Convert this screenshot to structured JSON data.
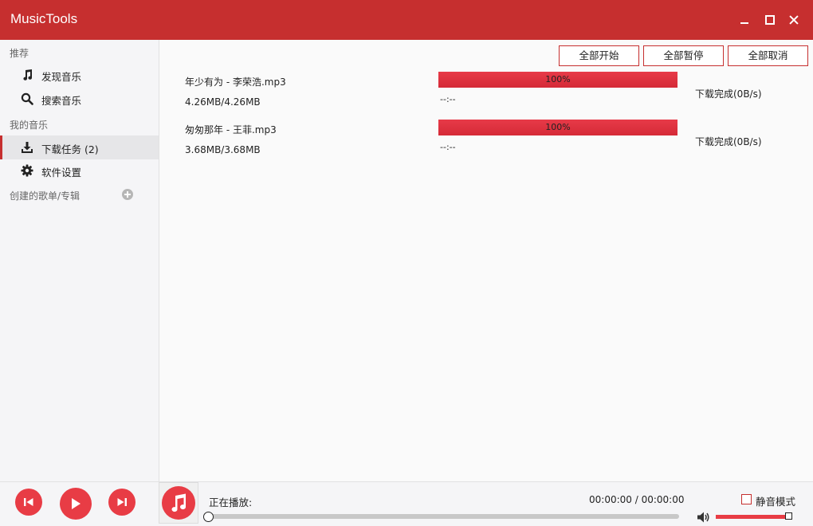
{
  "app": {
    "title": "MusicTools"
  },
  "window_controls": {
    "minimize": "minimize",
    "maximize": "maximize",
    "close": "close"
  },
  "sidebar": {
    "section_recommend": "推荐",
    "discover": "发现音乐",
    "search": "搜索音乐",
    "section_my_music": "我的音乐",
    "downloads": "下载任务 (2)",
    "settings": "软件设置",
    "section_playlists": "创建的歌单/专辑"
  },
  "toolbar": {
    "start_all": "全部开始",
    "pause_all": "全部暂停",
    "cancel_all": "全部取消"
  },
  "downloads": [
    {
      "name": "年少有为 - 李荣浩.mp3",
      "size": "4.26MB/4.26MB",
      "progress": 1.0,
      "progress_label": "100%",
      "time": "--:--",
      "status": "下载完成(0B/s)"
    },
    {
      "name": "匆匆那年 - 王菲.mp3",
      "size": "3.68MB/3.68MB",
      "progress": 1.0,
      "progress_label": "100%",
      "time": "--:--",
      "status": "下载完成(0B/s)"
    }
  ],
  "player": {
    "now_playing_label": "正在播放:",
    "time": "00:00:00 / 00:00:00",
    "playback_progress": 0.0,
    "volume": 0.95,
    "mute_label": "静音模式",
    "mute_checked": false
  },
  "colors": {
    "accent": "#c62f2f",
    "button_red": "#e83c45"
  },
  "icons": [
    "music-note-icon",
    "search-icon",
    "download-icon",
    "gear-icon",
    "plus-circle-icon",
    "previous-icon",
    "play-icon",
    "next-icon",
    "volume-icon"
  ]
}
